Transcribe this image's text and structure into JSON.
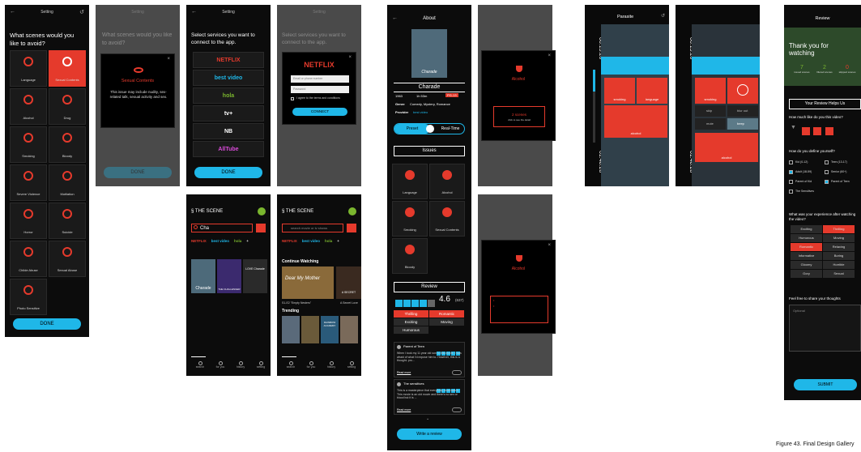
{
  "screen1": {
    "title": "Setting",
    "question": "What scenes would you like to avoid?",
    "done": "DONE",
    "items": [
      {
        "label": "Language",
        "color": "#e53a2c"
      },
      {
        "label": "Sexual Contents",
        "color": "#ffffff"
      },
      {
        "label": "Alcohol",
        "color": "#e53a2c"
      },
      {
        "label": "Drug",
        "color": "#e53a2c"
      },
      {
        "label": "Smoking",
        "color": "#e53a2c"
      },
      {
        "label": "Bloody",
        "color": "#e53a2c"
      },
      {
        "label": "Severe Violence",
        "color": "#e53a2c"
      },
      {
        "label": "Mutilation",
        "color": "#e53a2c"
      },
      {
        "label": "Horror",
        "color": "#e53a2c"
      },
      {
        "label": "Suicide",
        "color": "#e53a2c"
      },
      {
        "label": "Childe Abuse",
        "color": "#e53a2c"
      },
      {
        "label": "Sexual Abuse",
        "color": "#e53a2c"
      },
      {
        "label": "Photo Sensitive",
        "color": "#e53a2c"
      }
    ]
  },
  "screen2": {
    "title": "Setting",
    "question": "What scenes would you like to avoid?",
    "modal_title": "Sexual Contents",
    "modal_text": "This issue may include nudity, sex-related talk, sexual activity and sex.",
    "done": "DONE"
  },
  "screen3": {
    "title": "Setting",
    "question": "Select services you want to connect to the app.",
    "services": [
      "NETFLIX",
      "best video",
      "hola",
      "tv+",
      "NB",
      "AllTube"
    ],
    "done": "DONE"
  },
  "screen4": {
    "title": "Setting",
    "question": "Select services you want to connect to the app.",
    "brand": "NETFLIX",
    "email_ph": "Email or phone number",
    "password_ph": "Password",
    "agree": "I agree to the terms and conditions",
    "connect": "CONNECT"
  },
  "screen5": {
    "logo": "THE SCENE",
    "query": "Cha",
    "services": [
      "NETFLIX",
      "best video",
      "hola",
      "+"
    ],
    "posters": [
      "Charade",
      "THE CHALLENGER",
      "LOVE Charade"
    ],
    "nav": [
      "search",
      "for you",
      "history",
      "setting"
    ]
  },
  "screen6": {
    "logo": "THE SCENE",
    "placeholder": "search movie or tv shows",
    "services": [
      "NETFLIX",
      "best video",
      "hola",
      "+"
    ],
    "continue": "Continue Watching",
    "posters": [
      "Dear My Mother",
      "A SECRET"
    ],
    "ep_left": "S1-E2 \"Empty Nesters\"",
    "ep_right": "A Secret Love",
    "trending": "Trending",
    "trend_posters": [
      "",
      "",
      "RAINBOW ACADEMY",
      ""
    ],
    "nav": [
      "search",
      "for you",
      "history",
      "setting"
    ]
  },
  "about": {
    "title": "About",
    "movie": "Charade",
    "year": "1963",
    "runtime": "1h 53m",
    "rating": "PG-13",
    "genre_label": "Genre",
    "genre": "Comedy, Mystery, Romance",
    "provider_label": "Provider",
    "provider": "best video",
    "preset": "Preset",
    "realtime": "Real-Time",
    "issues": "Issues",
    "issue_items": [
      "Language",
      "Alcohol",
      "Smoking",
      "Sexual Contents",
      "Bloody"
    ],
    "review": "Review",
    "score": "4.6",
    "votes": "(637)",
    "tags": [
      "Thrilling",
      "Romantic",
      "Exciting",
      "Moving",
      "Humorous"
    ],
    "reviews": [
      {
        "user": "Parent of Teen",
        "text": "When I took my 11 year old son to this movie, I was afraid of what I'd expose him to. However, this is a thought- pro...",
        "more": "Read more"
      },
      {
        "user": "The sensitives",
        "text": "This is a masterpiece that everybody must watch. This movie is an old movie and there's no sex or blood but it is ...",
        "more": "Read more"
      }
    ],
    "write": "Write a review"
  },
  "alcohol1": {
    "title": "Alcohol",
    "text": "The video includes scenes of exposing alcohol or characters drinking alcohol.",
    "scenes": "2 scenes",
    "hint": "click to see the detail"
  },
  "alcohol2": {
    "title": "Alcohol",
    "text": "The video includes scenes of exposing alcohol or characters drinking alcohol.",
    "items": [
      "A man drink a wine.",
      "A man and woman drink together in the bar."
    ]
  },
  "player1": {
    "title": "Parasite",
    "time_top": "00:15:20",
    "time_bottom": "01:48:28",
    "tiles": [
      "smoking",
      "language",
      "alcohol"
    ]
  },
  "player2": {
    "time_top": "00:15:20",
    "time_bottom": "01:48:28",
    "tiles": [
      "smoking",
      "alcohol"
    ],
    "skip": "skip",
    "blur": "blur out",
    "mute": "mute",
    "beep": "beep"
  },
  "review": {
    "title": "Review",
    "thanks": "Thank you for watching",
    "stats": [
      {
        "n": "7",
        "l": "issued scenes"
      },
      {
        "n": "2",
        "l": "filtered scenes"
      },
      {
        "n": "0",
        "l": "skipped scenes"
      }
    ],
    "helps": "Your Review Helps Us",
    "q1": "How much like do you this video?",
    "q2": "How do you define yourself?",
    "defs": [
      "Kid (0-12)",
      "Teen (13-17)",
      "Adult (18-59)",
      "Senior (60+)",
      "Parent of Kid",
      "Parent of Teen",
      "The Sensitives"
    ],
    "q3": "What was your experience after watching the video?",
    "exp": [
      "Exciting",
      "Thrilling",
      "Humorous",
      "Moving",
      "Romantic",
      "Relaxing",
      "Informative",
      "Boring",
      "Gloomy",
      "Horrible",
      "Gory",
      "Sexual"
    ],
    "q4": "Feel free to share your thoughts",
    "optional": "Optional",
    "submit": "SUBMIT"
  },
  "caption": "Figure 43. Final Design Gallery"
}
